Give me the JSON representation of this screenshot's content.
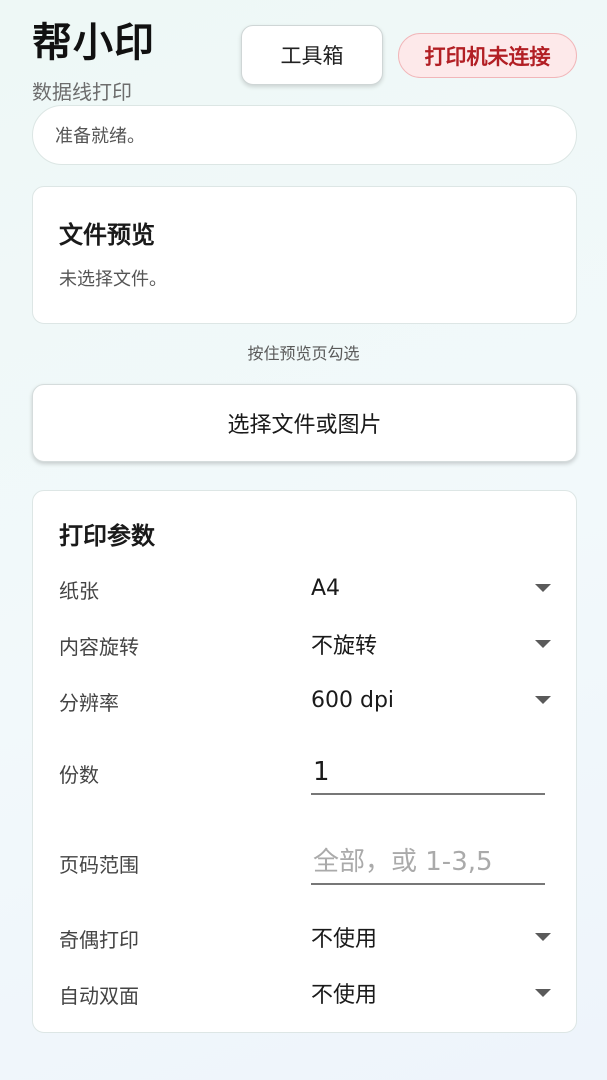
{
  "header": {
    "app_title": "帮小印",
    "app_subtitle": "数据线打印",
    "toolbox_label": "工具箱",
    "printer_status": "打印机未连接"
  },
  "status": {
    "message": "准备就绪。"
  },
  "preview": {
    "title": "文件预览",
    "empty_text": "未选择文件。",
    "hint": "按住预览页勾选"
  },
  "actions": {
    "select_file_label": "选择文件或图片"
  },
  "params": {
    "title": "打印参数",
    "paper": {
      "label": "纸张",
      "value": "A4"
    },
    "rotation": {
      "label": "内容旋转",
      "value": "不旋转"
    },
    "resolution": {
      "label": "分辨率",
      "value": "600 dpi"
    },
    "copies": {
      "label": "份数",
      "value": "1"
    },
    "page_range": {
      "label": "页码范围",
      "value": "",
      "placeholder": "全部，或 1-3,5"
    },
    "odd_even": {
      "label": "奇偶打印",
      "value": "不使用"
    },
    "duplex": {
      "label": "自动双面",
      "value": "不使用"
    }
  },
  "colors": {
    "accent_error": "#b21f24",
    "error_bg": "#fde9ea"
  },
  "icons": [
    "dropdown-arrow-icon"
  ]
}
